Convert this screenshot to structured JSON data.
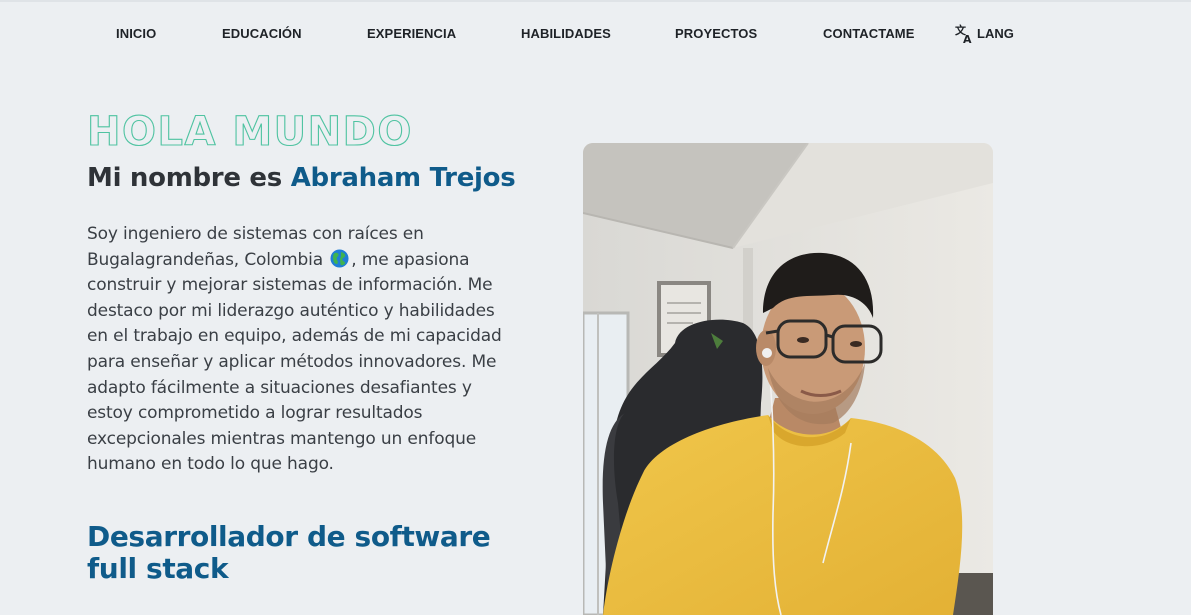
{
  "nav": {
    "items": [
      {
        "label": "INICIO"
      },
      {
        "label": "EDUCACIÓN"
      },
      {
        "label": "EXPERIENCIA"
      },
      {
        "label": "HABILIDADES"
      },
      {
        "label": "PROYECTOS"
      },
      {
        "label": "CONTACTAME"
      }
    ],
    "lang": {
      "label": "LANG",
      "icon": "translate-icon"
    }
  },
  "hero": {
    "greeting": "HOLA MUNDO",
    "intro_prefix": "Mi nombre es",
    "name": "Abraham Trejos",
    "bio_part1": "Soy ingeniero de sistemas con raíces en Bugalagrandeñas, Colombia",
    "bio_icon": "globe-icon",
    "bio_part2": ", me apasiona construir y mejorar sistemas de información. Me destaco por mi liderazgo auténtico y habilidades en el trabajo en equipo, además de mi capacidad para enseñar y aplicar métodos innovadores. Me adapto fácilmente a situaciones desafiantes y estoy comprometido a lograr resultados excepcionales mientras mantengo un enfoque humano en todo lo que hago.",
    "role": "Desarrollador de software full stack"
  },
  "colors": {
    "accent_blue": "#0f5b8a",
    "greeting_teal": "#4fc3a1",
    "background": "#eceff2"
  }
}
